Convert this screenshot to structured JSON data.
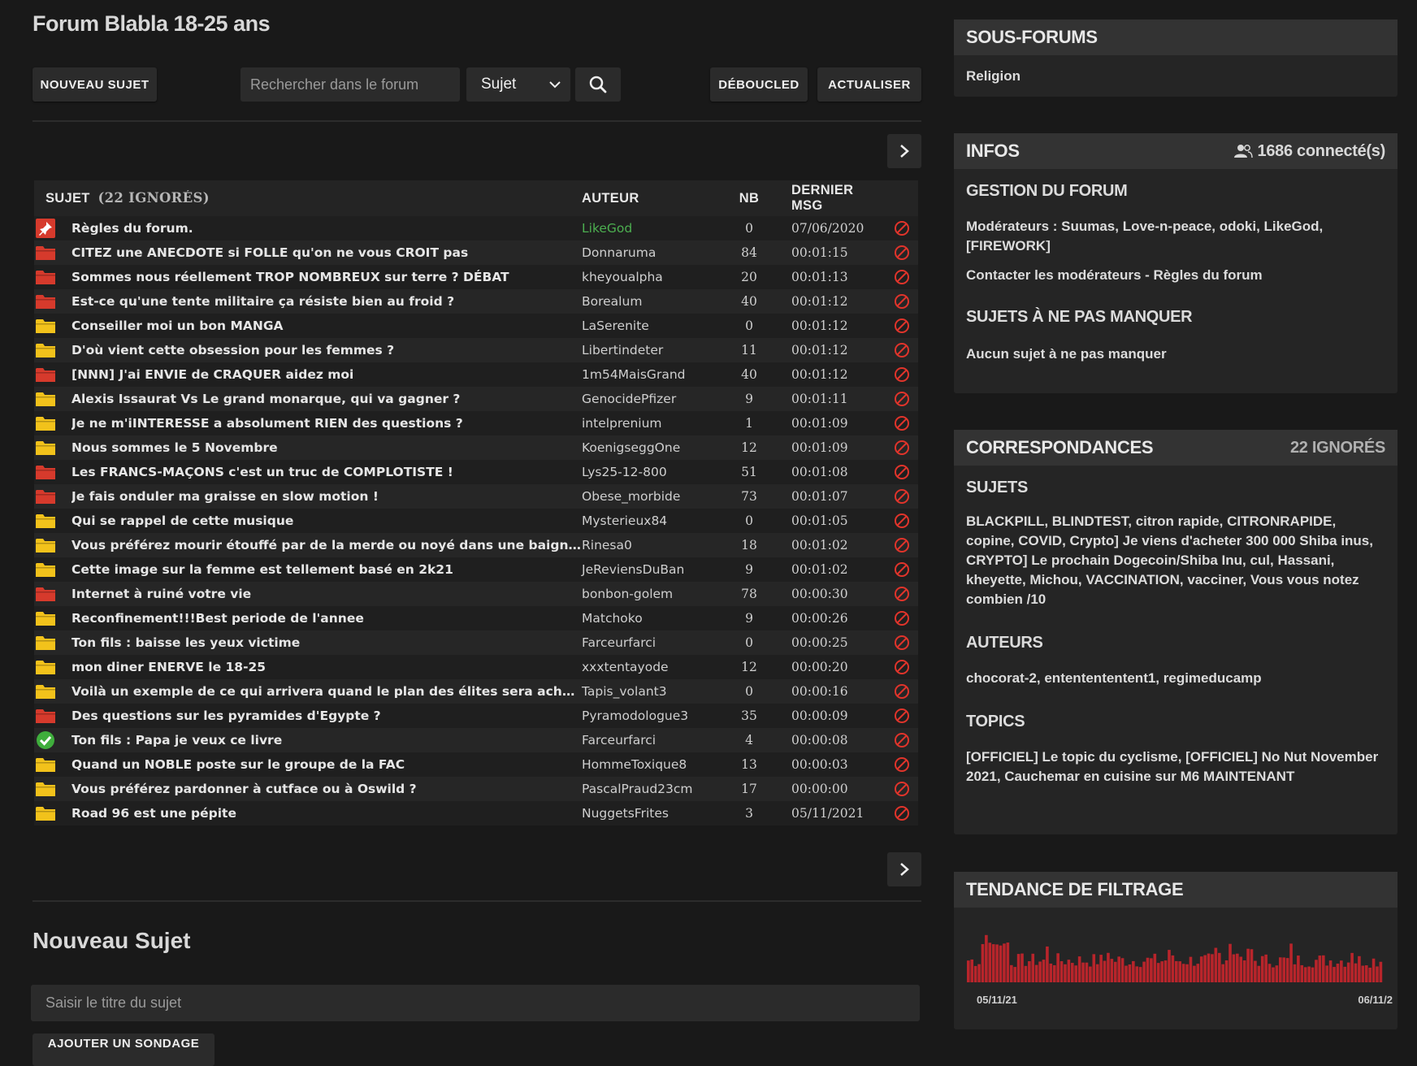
{
  "forum": {
    "title": "Forum Blabla 18-25 ans"
  },
  "toolbar": {
    "new_topic": "NOUVEAU SUJET",
    "search_placeholder": "Rechercher dans le forum",
    "search_scope": "Sujet",
    "debouclED": "DÉBOUCLED",
    "refresh": "ACTUALISER"
  },
  "table": {
    "headers": {
      "subject": "SUJET",
      "ignored": "(22 IGNORÉS)",
      "author": "AUTEUR",
      "nb": "NB",
      "last": "DERNIER MSG"
    },
    "rows": [
      {
        "icon": "pin",
        "subject": "Règles du forum.",
        "author": "LikeGod",
        "author_color": "#4caf50",
        "nb": "0",
        "last": "07/06/2020"
      },
      {
        "icon": "red",
        "subject": "CITEZ une ANECDOTE si FOLLE qu'on ne vous CROIT pas",
        "author": "Donnaruma",
        "nb": "84",
        "last": "00:01:15"
      },
      {
        "icon": "red",
        "subject": "Sommes nous réellement TROP NOMBREUX sur terre ? DÉBAT",
        "author": "kheyoualpha",
        "nb": "20",
        "last": "00:01:13"
      },
      {
        "icon": "red",
        "subject": "Est-ce qu'une tente militaire ça résiste bien au froid ?",
        "author": "Borealum",
        "nb": "40",
        "last": "00:01:12"
      },
      {
        "icon": "yellow",
        "subject": "Conseiller moi un bon MANGA",
        "author": "LaSerenite",
        "nb": "0",
        "last": "00:01:12"
      },
      {
        "icon": "yellow",
        "subject": "D'où vient cette obsession pour les femmes ?",
        "author": "Libertindeter",
        "nb": "11",
        "last": "00:01:12"
      },
      {
        "icon": "red",
        "subject": "[NNN] J'ai ENVIE de CRAQUER aidez moi",
        "author": "1m54MaisGrand",
        "nb": "40",
        "last": "00:01:12"
      },
      {
        "icon": "yellow",
        "subject": "Alexis Issaurat Vs Le grand monarque, qui va gagner ?",
        "author": "GenocidePfizer",
        "nb": "9",
        "last": "00:01:11"
      },
      {
        "icon": "yellow",
        "subject": "Je ne m'iINTERESSE a absolument RIEN des questions ?",
        "author": "intelprenium",
        "nb": "1",
        "last": "00:01:09"
      },
      {
        "icon": "yellow",
        "subject": "Nous sommes le 5 Novembre",
        "author": "KoenigseggOne",
        "nb": "12",
        "last": "00:01:09"
      },
      {
        "icon": "red",
        "subject": "Les FRANCS-MAÇONS c'est un truc de COMPLOTISTE !",
        "author": "Lys25-12-800",
        "nb": "51",
        "last": "00:01:08"
      },
      {
        "icon": "red",
        "subject": "Je fais onduler ma graisse en slow motion !",
        "author": "Obese_morbide",
        "nb": "73",
        "last": "00:01:07"
      },
      {
        "icon": "yellow",
        "subject": "Qui se rappel de cette musique",
        "author": "Mysterieux84",
        "nb": "0",
        "last": "00:01:05"
      },
      {
        "icon": "yellow",
        "subject": "Vous préférez mourir étouffé par de la merde ou noyé dans une baign…",
        "author": "Rinesa0",
        "nb": "18",
        "last": "00:01:02"
      },
      {
        "icon": "yellow",
        "subject": "Cette image sur la femme est tellement basé en 2k21",
        "author": "JeReviensDuBan",
        "nb": "9",
        "last": "00:01:02"
      },
      {
        "icon": "red",
        "subject": "Internet à ruiné votre vie",
        "author": "bonbon-golem",
        "nb": "78",
        "last": "00:00:30"
      },
      {
        "icon": "yellow",
        "subject": "Reconfinement!!!Best periode de l'annee",
        "author": "Matchoko",
        "nb": "9",
        "last": "00:00:26"
      },
      {
        "icon": "yellow",
        "subject": "Ton fils : baisse les yeux victime",
        "author": "Farceurfarci",
        "nb": "0",
        "last": "00:00:25"
      },
      {
        "icon": "yellow",
        "subject": "mon diner ENERVE le 18-25",
        "author": "xxxtentayode",
        "nb": "12",
        "last": "00:00:20"
      },
      {
        "icon": "yellow",
        "subject": "Voilà un exemple de ce qui arrivera quand le plan des élites sera achevé",
        "author": "Tapis_volant3",
        "nb": "0",
        "last": "00:00:16"
      },
      {
        "icon": "red",
        "subject": "Des questions sur les pyramides d'Egypte ?",
        "author": "Pyramodologue3",
        "nb": "35",
        "last": "00:00:09"
      },
      {
        "icon": "check",
        "subject": "Ton fils : Papa je veux ce livre",
        "author": "Farceurfarci",
        "nb": "4",
        "last": "00:00:08"
      },
      {
        "icon": "yellow",
        "subject": "Quand un NOBLE poste sur le groupe de la FAC",
        "author": "HommeToxique8",
        "nb": "13",
        "last": "00:00:03"
      },
      {
        "icon": "yellow",
        "subject": "Vous préférez pardonner à cutface ou à Oswild ?",
        "author": "PascalPraud23cm",
        "nb": "17",
        "last": "00:00:00"
      },
      {
        "icon": "yellow",
        "subject": "Road 96 est une pépite",
        "author": "NuggetsFrites",
        "nb": "3",
        "last": "05/11/2021"
      }
    ]
  },
  "new_topic": {
    "title": "Nouveau Sujet",
    "placeholder": "Saisir le titre du sujet",
    "poll_button": "AJOUTER UN SONDAGE"
  },
  "sidebar": {
    "subforums": {
      "title": "SOUS-FORUMS",
      "items": [
        "Religion"
      ]
    },
    "infos": {
      "title": "INFOS",
      "connected": "1686 connecté(s)",
      "management_title": "GESTION DU FORUM",
      "moderators": "Modérateurs : Suumas, Love-n-peace, odoki, LikeGod, [FIREWORK]",
      "contact": "Contacter les modérateurs - Règles du forum",
      "must_title": "SUJETS À NE PAS MANQUER",
      "must_text": "Aucun sujet à ne pas manquer"
    },
    "matches": {
      "title": "CORRESPONDANCES",
      "ignored": "22 IGNORÉS",
      "subjects_title": "SUJETS",
      "subjects_text": "BLACKPILL, BLINDTEST, citron rapide, CITRONRAPIDE, copine, COVID, Crypto] Je viens d'acheter 300 000 Shiba inus, CRYPTO] Le prochain Dogecoin/Shiba Inu, cul, Hassani, kheyette, Michou, VACCINATION, vacciner, Vous vous notez combien /10",
      "authors_title": "AUTEURS",
      "authors_text": "chocorat-2, ententententent1, regimeducamp",
      "topics_title": "TOPICS",
      "topics_text": "[OFFICIEL] Le topic du cyclisme, [OFFICIEL] No Nut November 2021, Cauchemar en cuisine sur M6 MAINTENANT"
    },
    "trend": {
      "title": "TENDANCE DE FILTRAGE",
      "start_label": "05/11/21",
      "end_label": "06/11/2"
    }
  },
  "colors": {
    "folder_red": "#d63a2c",
    "folder_yellow": "#f2c21b",
    "ignore_red": "#e0342b",
    "check_green": "#3fae3c",
    "spark_bar": "#b8252b"
  }
}
